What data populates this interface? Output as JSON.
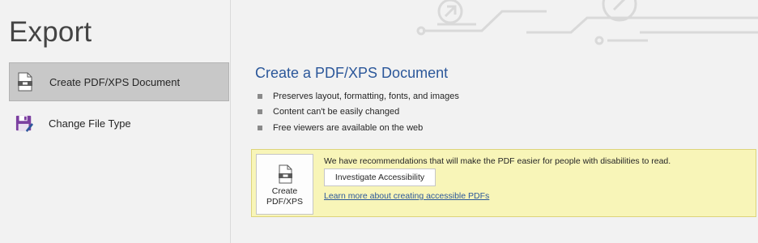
{
  "page": {
    "title": "Export"
  },
  "sidebar": {
    "items": [
      {
        "label": "Create PDF/XPS Document",
        "icon": "pdf-document-icon",
        "selected": true
      },
      {
        "label": "Change File Type",
        "icon": "save-as-icon",
        "selected": false
      }
    ]
  },
  "main": {
    "title": "Create a PDF/XPS Document",
    "bullets": [
      "Preserves layout, formatting, fonts, and images",
      "Content can't be easily changed",
      "Free viewers are available on the web"
    ],
    "action": {
      "create_button_label": "Create\nPDF/XPS",
      "recommendation_text": "We have recommendations that will make the PDF easier for people with disabilities to read.",
      "investigate_button_label": "Investigate Accessibility",
      "learn_more_link": "Learn more about creating accessible PDFs"
    }
  },
  "colors": {
    "accent": "#2b579a",
    "panel_background": "#f8f5b8",
    "selected_item": "#c8c8c8",
    "icon_purple": "#7b3fa0"
  }
}
